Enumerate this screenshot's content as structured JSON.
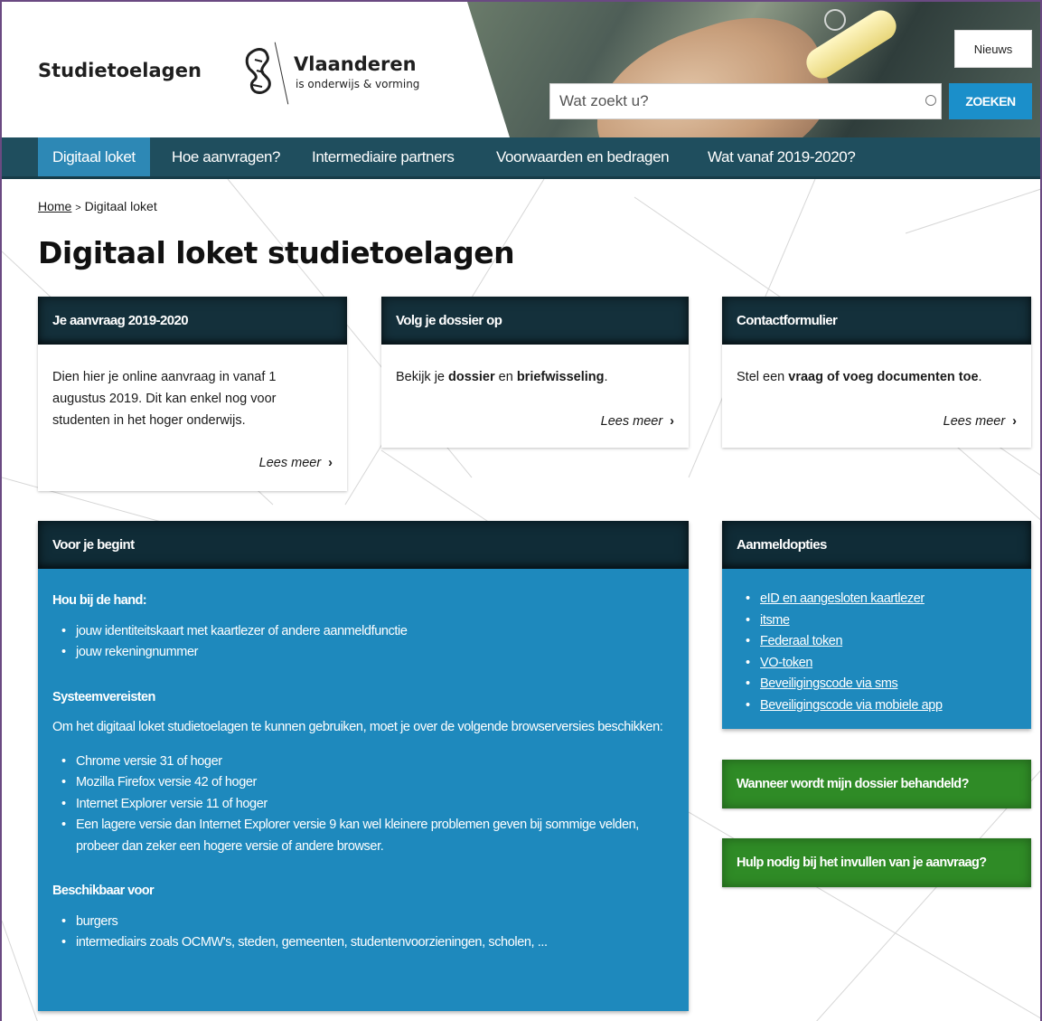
{
  "header": {
    "site_title": "Studietoelagen",
    "logo_name": "Vlaanderen",
    "logo_subtitle": "is onderwijs & vorming",
    "news_button": "Nieuws",
    "search": {
      "placeholder": "Wat zoekt u?",
      "button": "ZOEKEN"
    }
  },
  "nav": {
    "items": [
      {
        "label": "Digitaal loket",
        "active": true
      },
      {
        "label": "Hoe aanvragen?"
      },
      {
        "label": "Intermediaire partners"
      },
      {
        "label": "Voorwaarden en bedragen"
      },
      {
        "label": "Wat vanaf 2019-2020?"
      }
    ]
  },
  "breadcrumb": {
    "home": "Home",
    "separator": ">",
    "current": "Digitaal loket"
  },
  "page_title": "Digitaal loket studietoelagen",
  "cards": [
    {
      "title": "Je aanvraag 2019-2020",
      "body": "Dien hier je online aanvraag in vanaf 1 augustus 2019. Dit kan enkel nog voor studenten in het hoger onderwijs.",
      "link": "Lees meer"
    },
    {
      "title": "Volg je dossier op",
      "body_pre": "Bekijk je ",
      "body_bold1": "dossier",
      "body_mid": " en ",
      "body_bold2": "briefwisseling",
      "body_post": ".",
      "link": "Lees meer"
    },
    {
      "title": "Contactformulier",
      "body_pre": "Stel een ",
      "body_bold1": "vraag of voeg documenten toe",
      "body_post": ".",
      "link": "Lees meer"
    }
  ],
  "voor_je_begint": {
    "title": "Voor je begint",
    "section1_title": "Hou bij de hand:",
    "section1_items": [
      "jouw identiteitskaart met kaartlezer of andere aanmeldfunctie",
      "jouw rekeningnummer"
    ],
    "section2_title": "Systeemvereisten",
    "section2_text": "Om het digitaal loket studietoelagen te kunnen gebruiken, moet je over de volgende browserversies beschikken:",
    "section2_items": [
      "Chrome versie 31 of hoger",
      "Mozilla Firefox versie 42 of hoger",
      "Internet Explorer versie 11 of hoger",
      "Een lagere versie dan Internet Explorer versie 9 kan wel kleinere problemen geven bij sommige velden, probeer dan zeker een hogere versie of andere browser."
    ],
    "section3_title": "Beschikbaar voor",
    "section3_items": [
      "burgers",
      "intermediairs zoals OCMW's, steden, gemeenten, studentenvoorzieningen, scholen, ..."
    ]
  },
  "aanmeldopties": {
    "title": "Aanmeldopties",
    "items": [
      "eID en aangesloten kaartlezer",
      "itsme",
      "Federaal token",
      "VO-token",
      "Beveiligingscode via sms",
      "Beveiligingscode via mobiele app"
    ]
  },
  "buttons": {
    "dossier_behandeld": "Wanneer wordt mijn dossier behandeld?",
    "hulp_nodig": "Hulp nodig bij het invullen van je aanvraag?"
  },
  "colors": {
    "nav_bg": "#1f4e5e",
    "nav_active": "#2d88b5",
    "card_head": "#14303b",
    "panel_blue": "#1e89bd",
    "green": "#2f8b26",
    "search_button": "#1b8fca"
  }
}
